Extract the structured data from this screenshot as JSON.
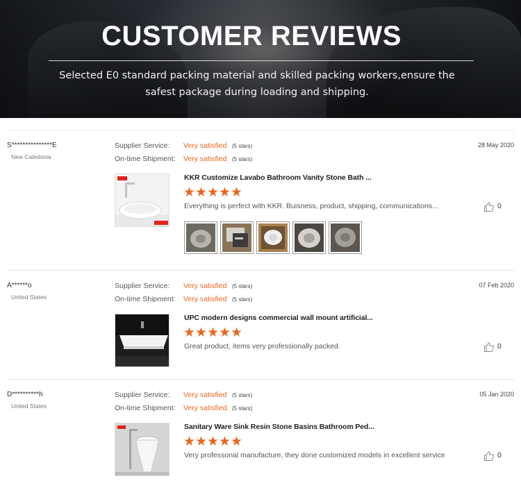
{
  "banner": {
    "title": "CUSTOMER REVIEWS",
    "subtitle": "Selected E0 standard packing material and skilled packing workers,ensure the safest package during loading and shipping."
  },
  "labels": {
    "supplier_service": "Supplier Service:",
    "ontime_shipment": "On-time Shipment:"
  },
  "reviews": [
    {
      "reviewer": "S***************E",
      "country": "New Caledonia",
      "date": "28 May 2020",
      "supplier_service": "Very satisfied",
      "supplier_service_stars": "(5 stars)",
      "ontime_shipment": "Very satisfied",
      "ontime_shipment_stars": "(5 stars)",
      "product_title": "KKR Customize Lavabo Bathroom Vanity Stone Bath ...",
      "rating": 5,
      "comment": "Everything is perfect with KKR. Buisness, product, shipping, communications...",
      "likes": "0"
    },
    {
      "reviewer": "A******o",
      "country": "United States",
      "date": "07 Feb 2020",
      "supplier_service": "Very satisfied",
      "supplier_service_stars": "(5 stars)",
      "ontime_shipment": "Very satisfied",
      "ontime_shipment_stars": "(5 stars)",
      "product_title": "UPC modern designs commercial wall mount artificial...",
      "rating": 5,
      "comment": "Great product, items very professionally packed.",
      "likes": "0"
    },
    {
      "reviewer": "D**********h",
      "country": "United States",
      "date": "05 Jan 2020",
      "supplier_service": "Very satisfied",
      "supplier_service_stars": "(5 stars)",
      "ontime_shipment": "Very satisfied",
      "ontime_shipment_stars": "(5 stars)",
      "product_title": "Sanitary Ware Sink Resin Stone Basins Bathroom Ped...",
      "rating": 5,
      "comment": "Very professonal manufacture, they done customized models in excellent service",
      "likes": "0"
    }
  ],
  "colors": {
    "accent": "#e8661c",
    "brand_red": "#e2231a"
  },
  "icons": {
    "like": "thumbs-up-icon",
    "star": "star-icon"
  }
}
